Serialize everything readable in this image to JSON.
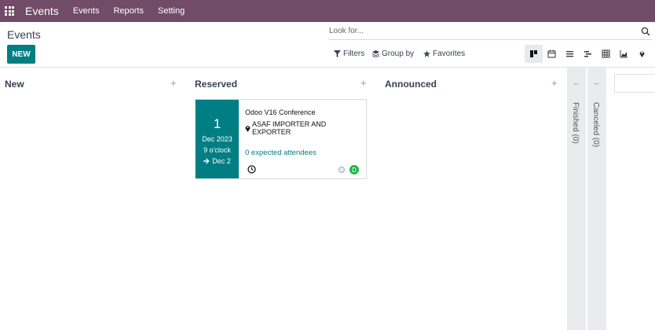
{
  "navbar": {
    "brand": "Events",
    "menu": [
      "Events",
      "Reports",
      "Setting"
    ]
  },
  "control_panel": {
    "title": "Events",
    "search_placeholder": "Look for...",
    "new_label": "NEW",
    "filters_label": "Filters",
    "group_by_label": "Group by",
    "favorites_label": "Favorites",
    "views": [
      "kanban",
      "calendar",
      "list",
      "gantt",
      "pivot",
      "graph",
      "map"
    ],
    "active_view": "kanban"
  },
  "kanban": {
    "columns": [
      {
        "title": "New",
        "add": "+"
      },
      {
        "title": "Reserved",
        "add": "+"
      },
      {
        "title": "Announced",
        "add": "+"
      }
    ],
    "folded_columns": [
      {
        "label": "Finished (0)",
        "expand": "↔"
      },
      {
        "label": "Canceled (0)",
        "expand": "↔"
      }
    ],
    "card": {
      "day": "1",
      "month_year": "Dec 2023",
      "time": "9 o'clock",
      "end": "Dec 2",
      "name": "Odoo V16 Conference",
      "location": "ASAF IMPORTER AND EXPORTER",
      "attendees": "0 expected attendees",
      "avatar_initial": "D"
    }
  },
  "colors": {
    "navbar": "#714b67",
    "primary": "#017e84",
    "avatar": "#21b44b"
  }
}
